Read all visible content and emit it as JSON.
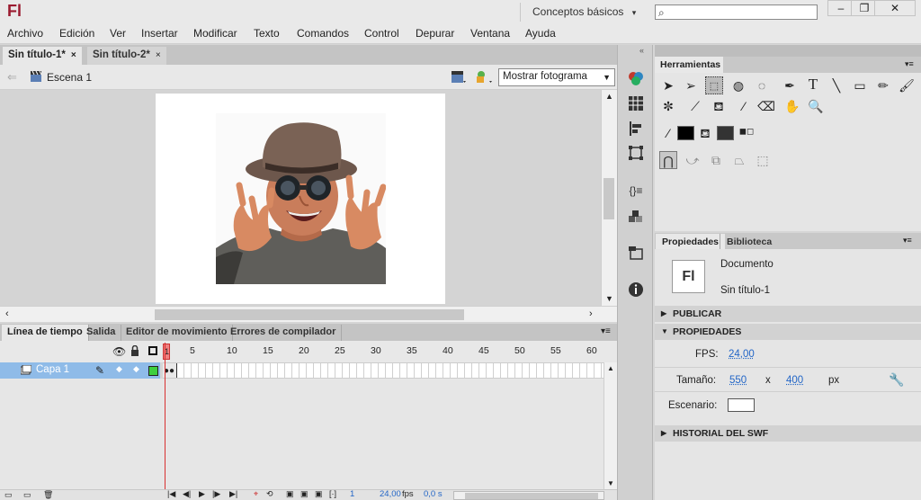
{
  "app": {
    "logo": "Fl",
    "workspace": "Conceptos básicos",
    "workspace_caret": "▾"
  },
  "window_controls": {
    "minimize": "–",
    "restore": "❐",
    "close": "✕"
  },
  "menu": [
    "Archivo",
    "Edición",
    "Ver",
    "Insertar",
    "Modificar",
    "Texto",
    "Comandos",
    "Control",
    "Depurar",
    "Ventana",
    "Ayuda"
  ],
  "doc_tabs": [
    {
      "label": "Sin título-1*",
      "close": "×"
    },
    {
      "label": "Sin título-2*",
      "close": "×"
    }
  ],
  "scene": {
    "back_arrow": "⇐",
    "label": "Escena 1",
    "view_select": "Mostrar fotograma"
  },
  "timeline": {
    "tabs": [
      "Línea de tiempo",
      "Salida",
      "Editor de movimiento",
      "Errores de compilador"
    ],
    "frame_numbers": [
      "1",
      "5",
      "10",
      "15",
      "20",
      "25",
      "30",
      "35",
      "40",
      "45",
      "50",
      "55",
      "60"
    ],
    "layer_name": "Capa 1",
    "current_frame": "1",
    "fps": "24,00",
    "fps_unit": "fps",
    "time": "0,0 s"
  },
  "tools_panel": {
    "title": "Herramientas"
  },
  "properties": {
    "tabs": [
      "Propiedades",
      "Biblioteca"
    ],
    "doc_icon": "Fl",
    "doc_type": "Documento",
    "doc_name": "Sin título-1",
    "sections": {
      "publish": "PUBLICAR",
      "properties": "PROPIEDADES",
      "swf_history": "HISTORIAL DEL SWF"
    },
    "fps_label": "FPS:",
    "fps_value": "24,00",
    "size_label": "Tamaño:",
    "width": "550",
    "x": "x",
    "height": "400",
    "unit": "px",
    "stage_label": "Escenario:",
    "stage_color": "#ffffff"
  },
  "colors": {
    "playhead": "#d83030",
    "selected_layer": "#8fbbe8",
    "link": "#2366c7"
  }
}
